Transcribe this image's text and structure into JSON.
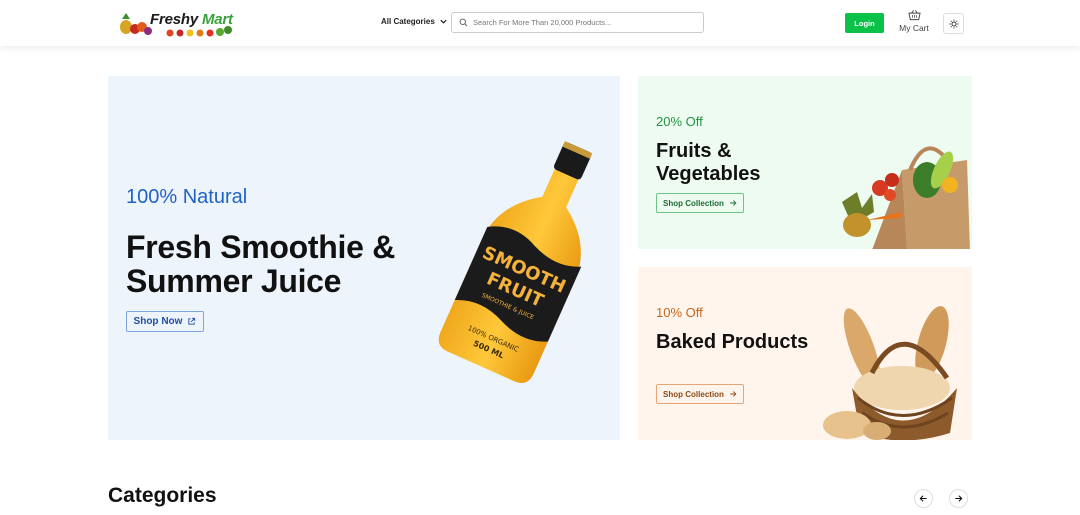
{
  "brand": {
    "name_part1": "Freshy",
    "name_part2": "Mart"
  },
  "header": {
    "category_label": "All Categories",
    "search_placeholder": "Search For More Than 20,000 Products...",
    "login_label": "Login",
    "cart_label": "My Cart"
  },
  "hero": {
    "eyebrow": "100% Natural",
    "title": "Fresh Smoothie & Summer Juice",
    "button_label": "Shop Now",
    "bottle_label": {
      "line1": "SMOOTH",
      "line2": "FRUIT",
      "sub": "SMOOTHIE & JUICE",
      "line3": "100% ORGANIC",
      "line4": "500 ML"
    }
  },
  "promos": [
    {
      "eyebrow": "20% Off",
      "title": "Fruits & Vegetables",
      "button_label": "Shop Collection"
    },
    {
      "eyebrow": "10% Off",
      "title": "Baked Products",
      "button_label": "Shop Collection"
    }
  ],
  "categories": {
    "title": "Categories"
  },
  "colors": {
    "accent_green": "#0ac249",
    "hero_blue": "#1f62c8",
    "promo_green_bg": "#eefbf1",
    "promo_orange_bg": "#fff5ec",
    "hero_bg": "#eef4fc"
  }
}
